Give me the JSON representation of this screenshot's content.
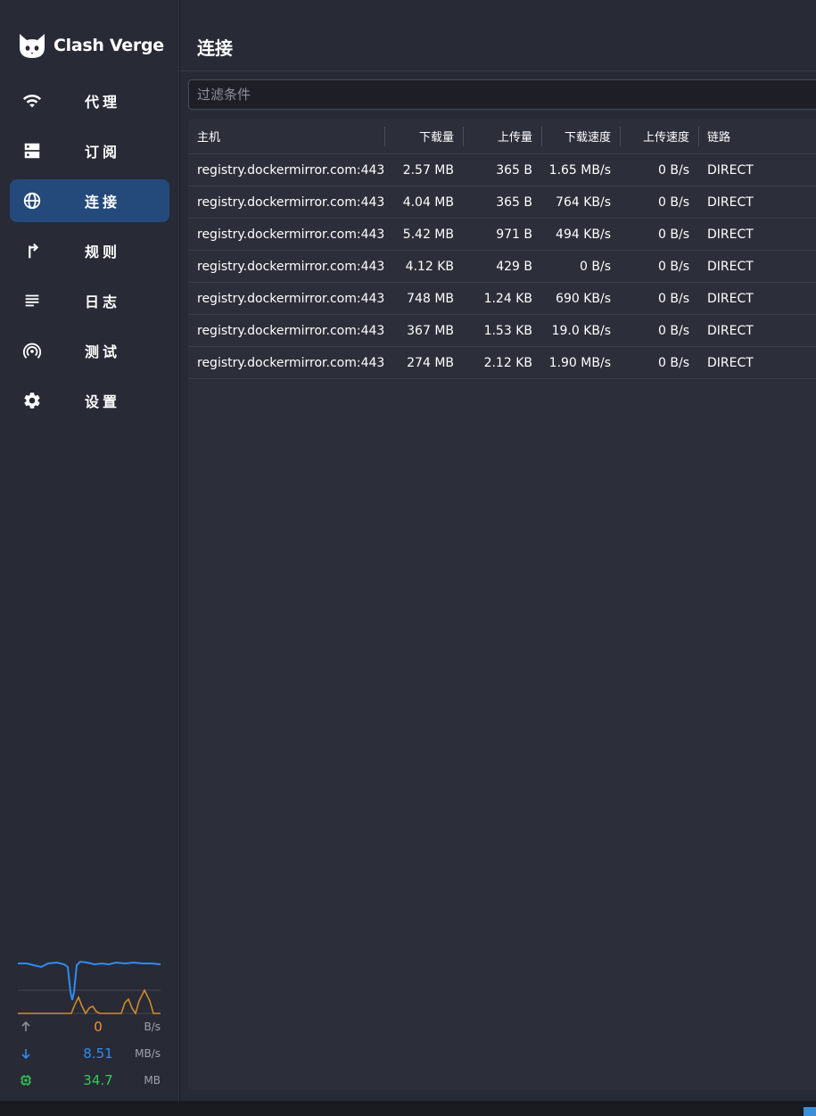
{
  "app": {
    "name": "Clash Verge"
  },
  "nav": [
    {
      "label": "代理",
      "icon": "wifi-icon",
      "active": false
    },
    {
      "label": "订阅",
      "icon": "server-icon",
      "active": false
    },
    {
      "label": "连接",
      "icon": "globe-icon",
      "active": true
    },
    {
      "label": "规则",
      "icon": "fork-icon",
      "active": false
    },
    {
      "label": "日志",
      "icon": "list-icon",
      "active": false
    },
    {
      "label": "测试",
      "icon": "broadcast-icon",
      "active": false
    },
    {
      "label": "设置",
      "icon": "gear-icon",
      "active": false
    }
  ],
  "traffic": {
    "upload": {
      "value": "0",
      "unit": "B/s",
      "color": "#f0962e"
    },
    "download": {
      "value": "8.51",
      "unit": "MB/s",
      "color": "#2f8cf0"
    },
    "memory": {
      "value": "34.7",
      "unit": "MB",
      "color": "#33cc55"
    }
  },
  "page": {
    "title": "连接"
  },
  "filter": {
    "placeholder": "过滤条件",
    "value": ""
  },
  "table": {
    "columns": [
      "主机",
      "下载量",
      "上传量",
      "下载速度",
      "上传速度",
      "链路"
    ],
    "rows": [
      [
        "registry.dockermirror.com:443",
        "2.57 MB",
        "365 B",
        "1.65 MB/s",
        "0 B/s",
        "DIRECT"
      ],
      [
        "registry.dockermirror.com:443",
        "4.04 MB",
        "365 B",
        "764 KB/s",
        "0 B/s",
        "DIRECT"
      ],
      [
        "registry.dockermirror.com:443",
        "5.42 MB",
        "971 B",
        "494 KB/s",
        "0 B/s",
        "DIRECT"
      ],
      [
        "registry.dockermirror.com:443",
        "4.12 KB",
        "429 B",
        "0 B/s",
        "0 B/s",
        "DIRECT"
      ],
      [
        "registry.dockermirror.com:443",
        "748 MB",
        "1.24 KB",
        "690 KB/s",
        "0 B/s",
        "DIRECT"
      ],
      [
        "registry.dockermirror.com:443",
        "367 MB",
        "1.53 KB",
        "19.0 KB/s",
        "0 B/s",
        "DIRECT"
      ],
      [
        "registry.dockermirror.com:443",
        "274 MB",
        "2.12 KB",
        "1.90 MB/s",
        "0 B/s",
        "DIRECT"
      ]
    ]
  }
}
